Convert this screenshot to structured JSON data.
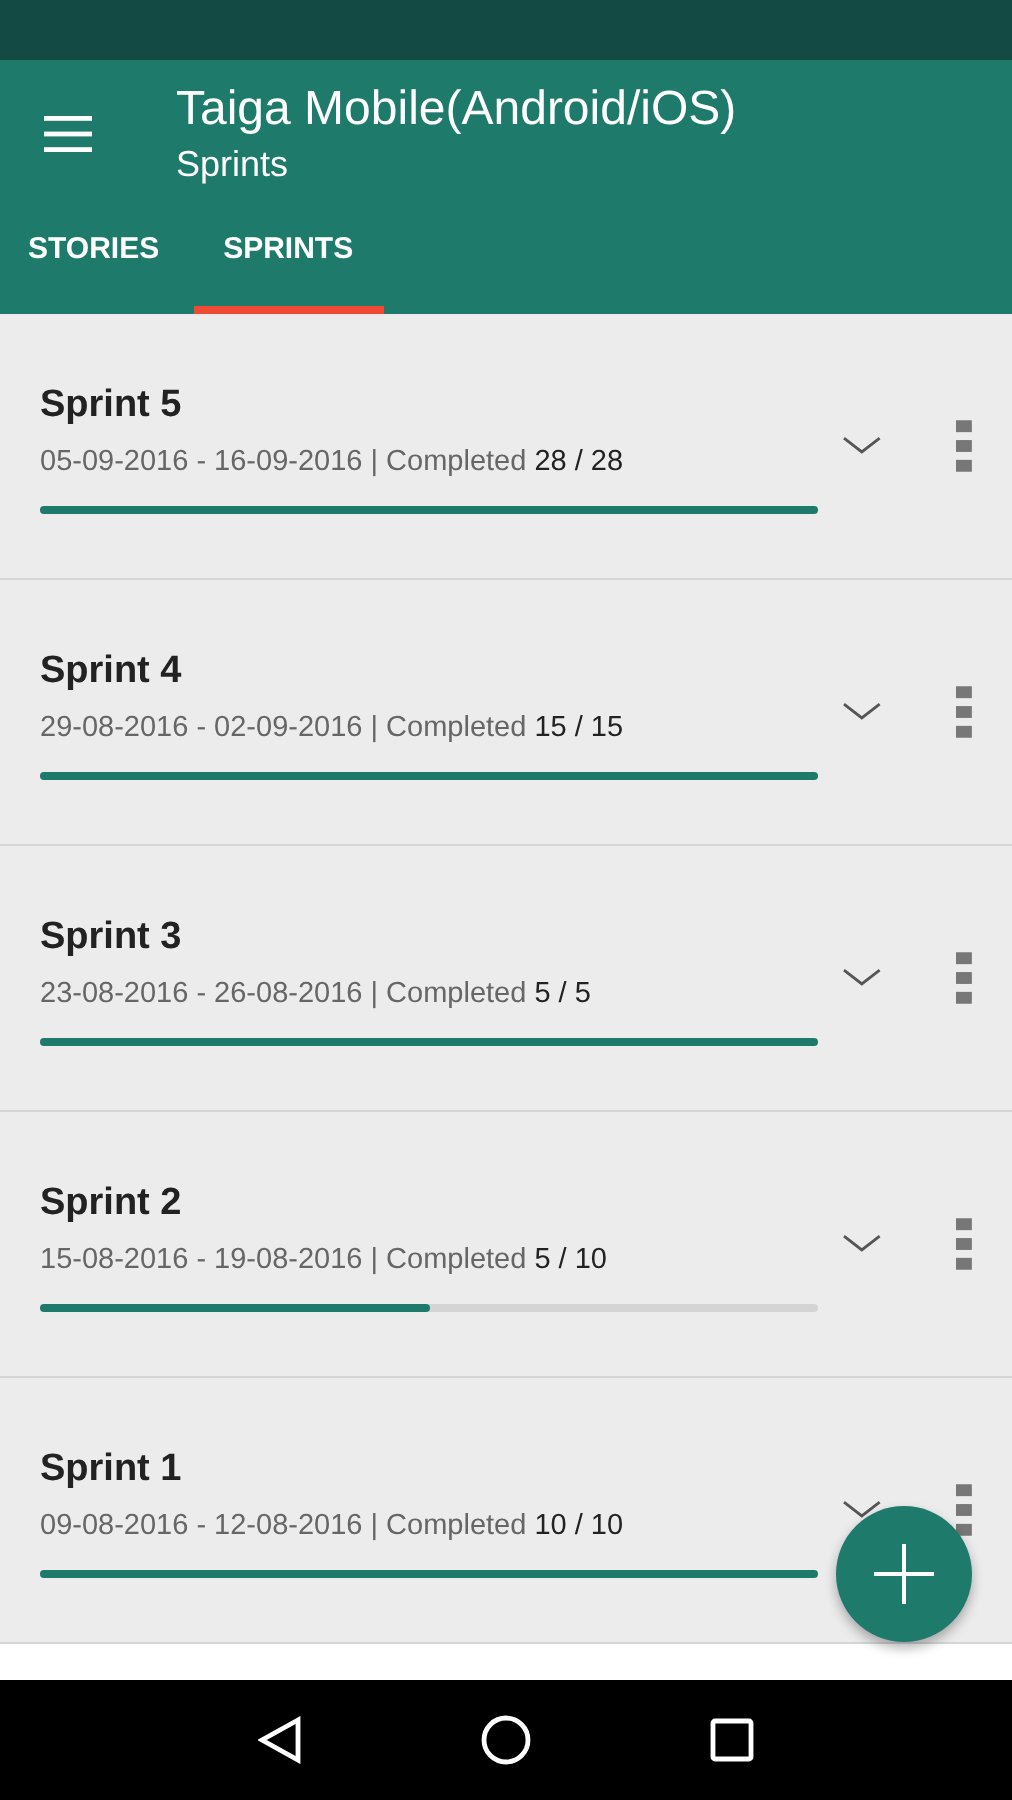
{
  "app_bar": {
    "title": "Taiga Mobile(Android/iOS)",
    "subtitle": "Sprints"
  },
  "tabs": [
    {
      "label": "STORIES",
      "selected": false
    },
    {
      "label": "SPRINTS",
      "selected": true
    }
  ],
  "sprints": [
    {
      "name": "Sprint 5",
      "dates": "05-09-2016 - 16-09-2016 | Completed",
      "count": "28 / 28",
      "level": 1
    },
    {
      "name": "Sprint 4",
      "dates": "29-08-2016 - 02-09-2016 | Completed",
      "count": "15 / 15",
      "level": 1
    },
    {
      "name": "Sprint 3",
      "dates": "23-08-2016 - 26-08-2016 | Completed",
      "count": "5 / 5",
      "level": 1
    },
    {
      "name": "Sprint 2",
      "dates": "15-08-2016 - 19-08-2016 | Completed",
      "count": "5 / 10",
      "level": 0.5
    },
    {
      "name": "Sprint 1",
      "dates": "09-08-2016 - 12-08-2016 | Completed",
      "count": "10 / 10",
      "level": 1
    }
  ]
}
